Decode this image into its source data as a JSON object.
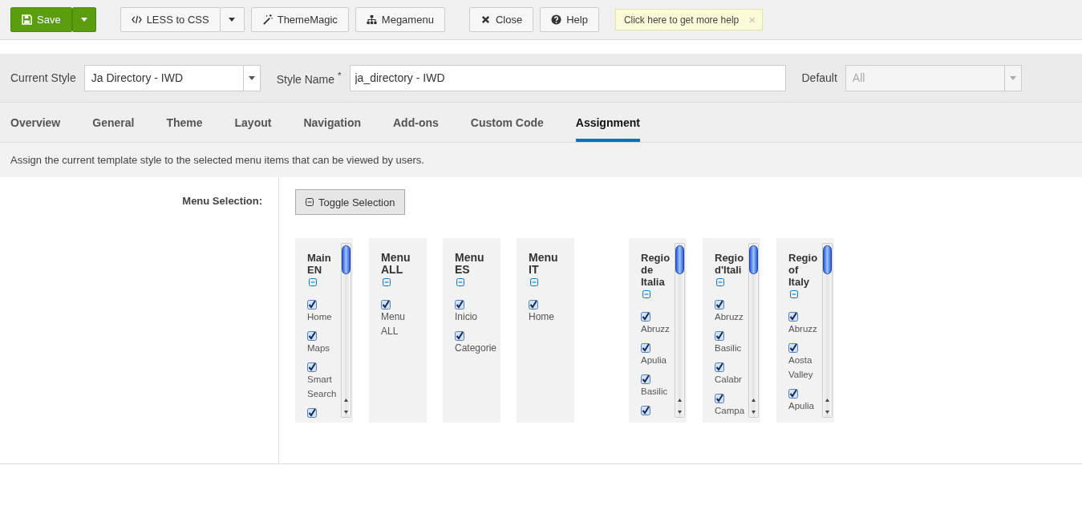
{
  "toolbar": {
    "buttons": [
      {
        "kind": "primary",
        "label": "Save",
        "split": true
      },
      {
        "kind": "code",
        "label": "LESS to CSS",
        "split": true
      },
      {
        "kind": "wand",
        "label": "ThemeMagic",
        "split": false
      },
      {
        "kind": "sitemap",
        "label": "Megamenu",
        "split": false
      },
      {
        "kind": "close",
        "label": "Close",
        "split": false
      },
      {
        "kind": "help",
        "label": "Help",
        "split": false
      }
    ],
    "tooltip": {
      "text": "Click here to get more help",
      "close": "×"
    }
  },
  "style_bar": {
    "current_style": {
      "label": "Current Style",
      "value": "Ja Directory - IWD"
    },
    "style_name": {
      "label": "Style Name",
      "required": "*",
      "value": "ja_directory - IWD"
    },
    "default": {
      "label": "Default",
      "value": "All",
      "disabled": true
    }
  },
  "tabs": [
    {
      "label": "Overview",
      "selected": false
    },
    {
      "label": "General",
      "selected": false
    },
    {
      "label": "Theme",
      "selected": false
    },
    {
      "label": "Layout",
      "selected": false
    },
    {
      "label": "Navigation",
      "selected": false
    },
    {
      "label": "Add-ons",
      "selected": false
    },
    {
      "label": "Custom Code",
      "selected": false
    },
    {
      "label": "Assignment",
      "selected": true
    }
  ],
  "description": "Assign the current template style to the selected menu items that can be viewed by users.",
  "menu_selection": {
    "label": "Menu Selection:",
    "toggle_button": "Toggle Selection",
    "groups": [
      [
        {
          "title": "Main EN",
          "scrollable": true,
          "items": [
            {
              "label": "Home",
              "checked": true
            },
            {
              "label": "Maps",
              "checked": true
            },
            {
              "label": "Smart Search",
              "checked": true
            },
            {
              "checked": true
            }
          ]
        },
        {
          "title": "Menu ALL",
          "scrollable": false,
          "items": [
            {
              "label": "Menu ALL",
              "checked": true
            }
          ]
        },
        {
          "title": "Menu ES",
          "scrollable": false,
          "items": [
            {
              "label": "Inicio",
              "checked": true
            },
            {
              "label": "Categorie",
              "checked": true
            }
          ]
        },
        {
          "title": "Menu IT",
          "scrollable": false,
          "items": [
            {
              "label": "Home",
              "checked": true
            }
          ]
        }
      ],
      [
        {
          "title": "Regio de Italia",
          "scrollable": true,
          "items": [
            {
              "label": "Abruzz",
              "checked": true
            },
            {
              "label": "Apulia",
              "checked": true
            },
            {
              "label": "Basilic",
              "checked": true
            },
            {
              "checked": true
            }
          ]
        },
        {
          "title": "Regio d'Itali",
          "scrollable": true,
          "items": [
            {
              "label": "Abruzz",
              "checked": true
            },
            {
              "label": "Basilic",
              "checked": true
            },
            {
              "label": "Calabr",
              "checked": true
            },
            {
              "label": "Campa",
              "checked": true
            }
          ]
        },
        {
          "title": "Regio of Italy",
          "scrollable": true,
          "items": [
            {
              "label": "Abruzz",
              "checked": true
            },
            {
              "label": "Aosta Valley",
              "checked": true
            },
            {
              "label": "Apulia",
              "checked": true
            }
          ]
        }
      ]
    ]
  }
}
